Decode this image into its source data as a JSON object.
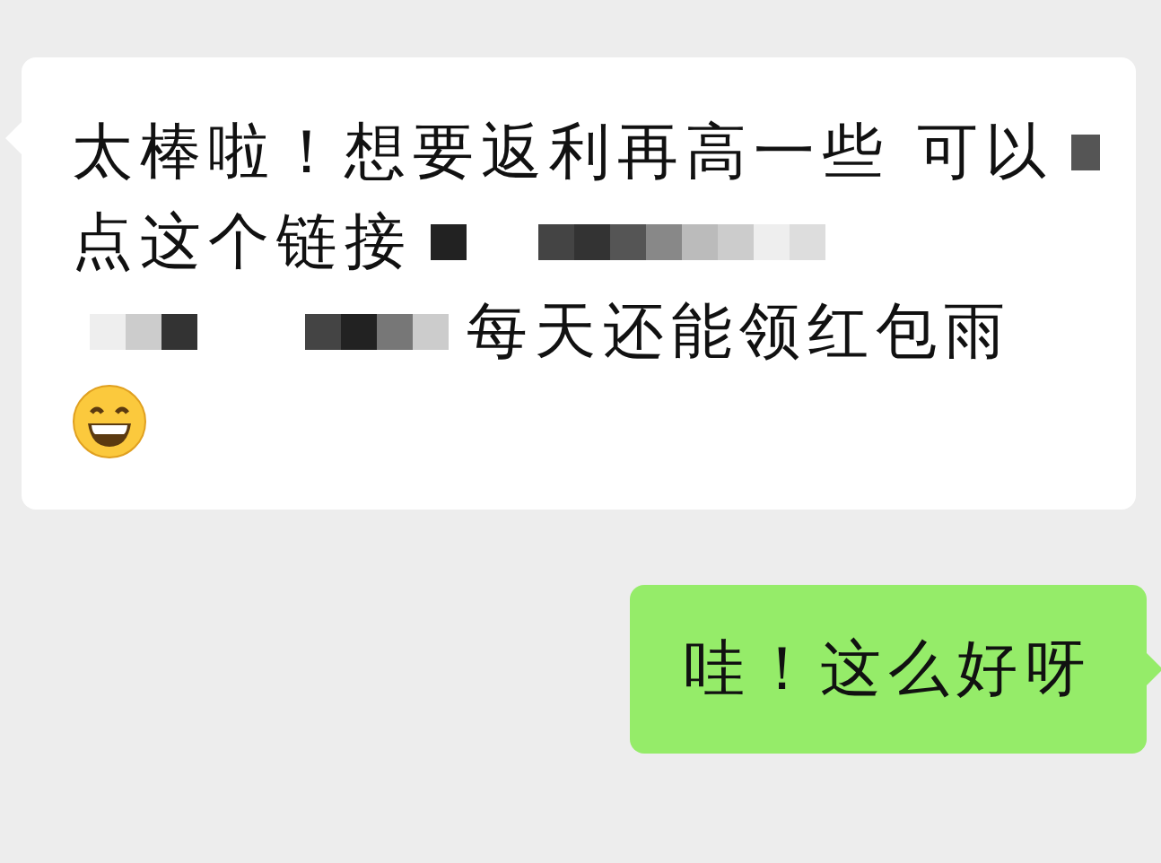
{
  "messages": [
    {
      "outgoing": false,
      "lines": [
        [
          {
            "kind": "text",
            "text": "太棒啦！想要返利再高一些 可以"
          },
          {
            "kind": "redacted"
          }
        ],
        [
          {
            "kind": "text",
            "text": "点这个链接"
          },
          {
            "kind": "redacted"
          }
        ],
        [
          {
            "kind": "redacted"
          },
          {
            "kind": "text",
            "text": "每天还能领红包雨"
          }
        ],
        [
          {
            "kind": "emoji"
          }
        ]
      ]
    },
    {
      "outgoing": true,
      "lines": [
        [
          {
            "kind": "text",
            "text": "哇！这么好呀"
          }
        ]
      ]
    }
  ]
}
